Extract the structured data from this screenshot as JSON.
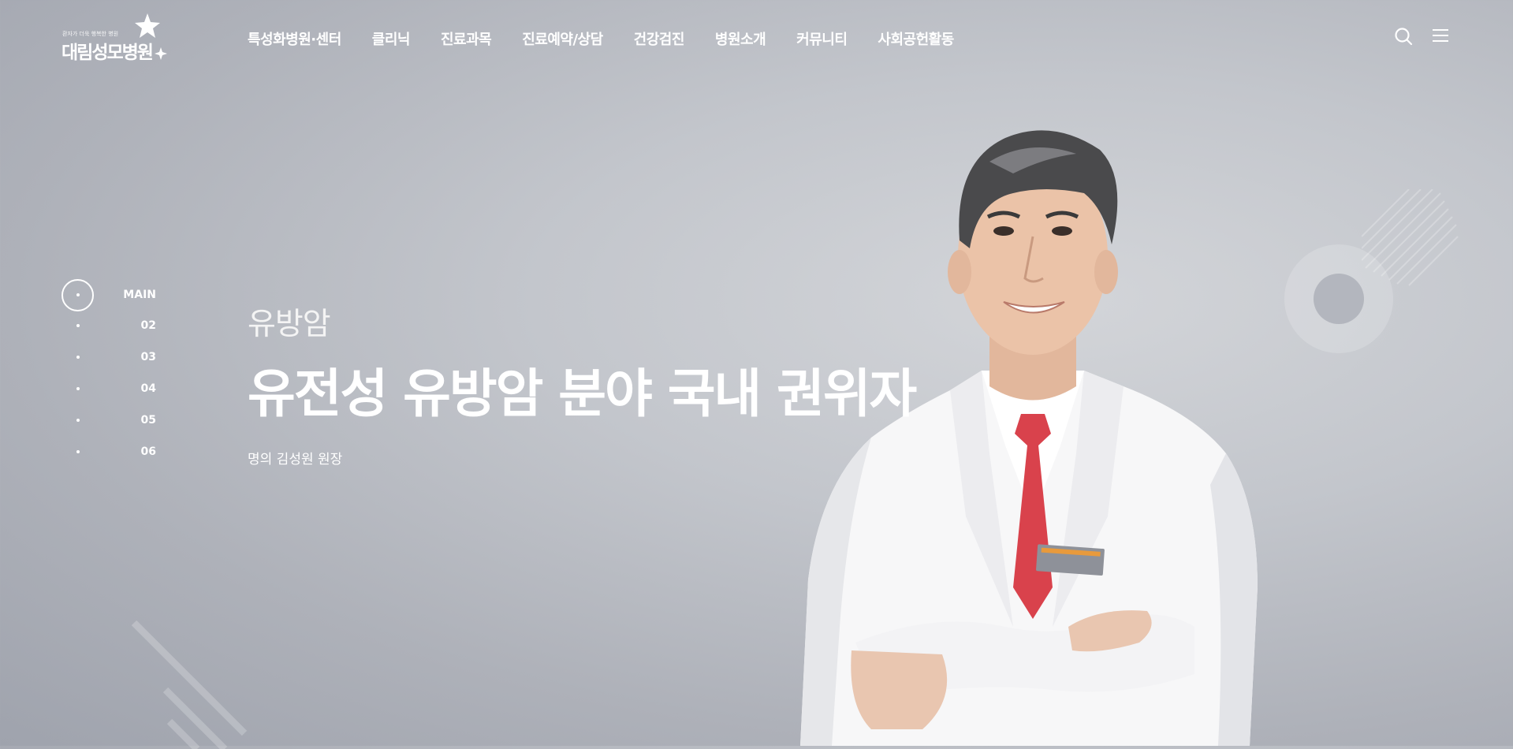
{
  "header": {
    "logo": {
      "tagline": "환자가 더욱 행복한 병원",
      "name": "대림성모병원"
    },
    "nav": [
      "특성화병원·센터",
      "클리닉",
      "진료과목",
      "진료예약/상담",
      "건강검진",
      "병원소개",
      "커뮤니티",
      "사회공헌활동"
    ],
    "icons": [
      "search-icon",
      "menu-icon"
    ]
  },
  "pager": [
    "MAIN",
    "02",
    "03",
    "04",
    "05",
    "06"
  ],
  "hero": {
    "subtitle": "유방암",
    "headline": "유전성 유방암 분야 국내 권위자",
    "caption": "명의 김성원 원장"
  },
  "colors": {
    "background": "#b4b7be",
    "text": "#ffffff",
    "tie": "#d9424c"
  }
}
